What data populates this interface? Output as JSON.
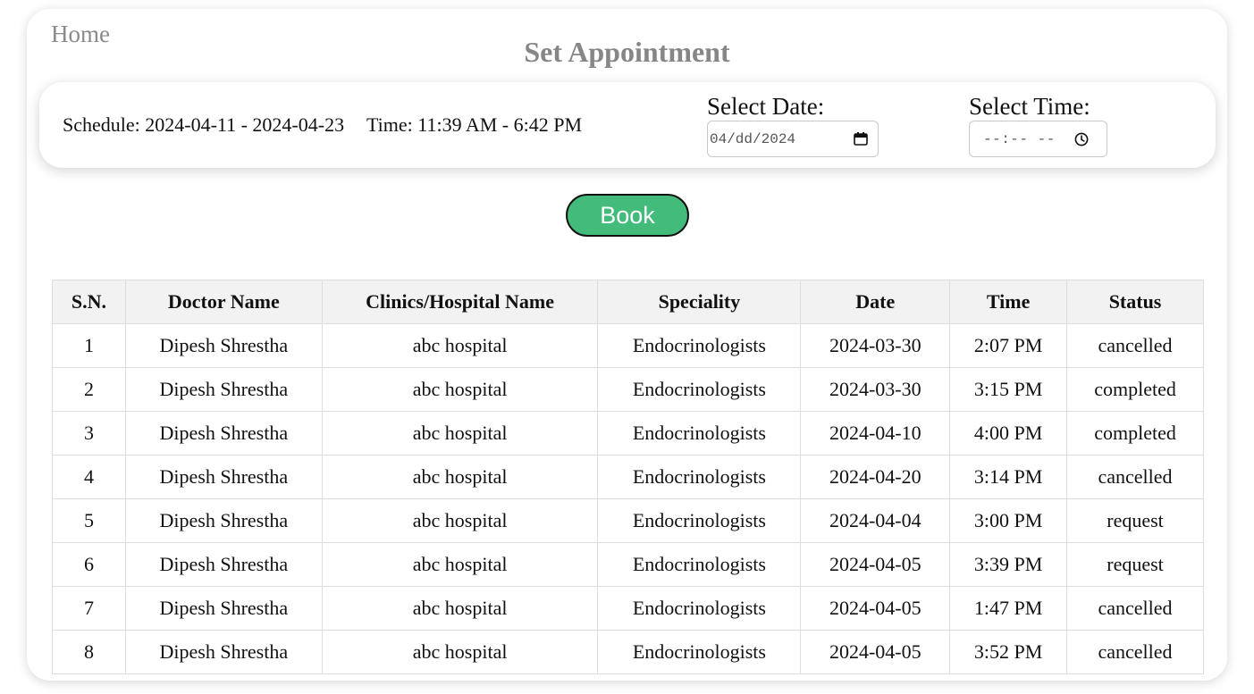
{
  "nav": {
    "home_label": "Home"
  },
  "page": {
    "title": "Set Appointment"
  },
  "schedule": {
    "range_text": "Schedule: 2024-04-11 - 2024-04-23",
    "time_text": "Time: 11:39 AM - 6:42 PM"
  },
  "form": {
    "date_label": "Select Date:",
    "date_value": "04/dd/2024",
    "time_label": "Select Time:",
    "time_value": "--:-- --",
    "book_label": "Book"
  },
  "icons": {
    "date_picker": "calendar-icon",
    "time_picker": "clock-icon"
  },
  "colors": {
    "book_button": "#42bb7b",
    "title": "#868686",
    "home_link": "#8a8a8a"
  },
  "table": {
    "headers": [
      "S.N.",
      "Doctor Name",
      "Clinics/Hospital Name",
      "Speciality",
      "Date",
      "Time",
      "Status"
    ],
    "rows": [
      [
        "1",
        "Dipesh Shrestha",
        "abc hospital",
        "Endocrinologists",
        "2024-03-30",
        "2:07 PM",
        "cancelled"
      ],
      [
        "2",
        "Dipesh Shrestha",
        "abc hospital",
        "Endocrinologists",
        "2024-03-30",
        "3:15 PM",
        "completed"
      ],
      [
        "3",
        "Dipesh Shrestha",
        "abc hospital",
        "Endocrinologists",
        "2024-04-10",
        "4:00 PM",
        "completed"
      ],
      [
        "4",
        "Dipesh Shrestha",
        "abc hospital",
        "Endocrinologists",
        "2024-04-20",
        "3:14 PM",
        "cancelled"
      ],
      [
        "5",
        "Dipesh Shrestha",
        "abc hospital",
        "Endocrinologists",
        "2024-04-04",
        "3:00 PM",
        "request"
      ],
      [
        "6",
        "Dipesh Shrestha",
        "abc hospital",
        "Endocrinologists",
        "2024-04-05",
        "3:39 PM",
        "request"
      ],
      [
        "7",
        "Dipesh Shrestha",
        "abc hospital",
        "Endocrinologists",
        "2024-04-05",
        "1:47 PM",
        "cancelled"
      ],
      [
        "8",
        "Dipesh Shrestha",
        "abc hospital",
        "Endocrinologists",
        "2024-04-05",
        "3:52 PM",
        "cancelled"
      ]
    ]
  }
}
